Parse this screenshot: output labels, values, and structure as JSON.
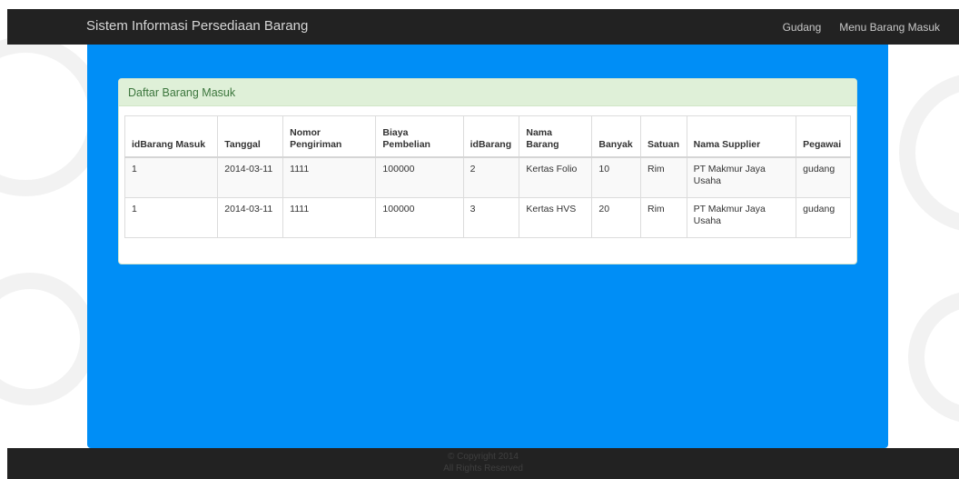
{
  "navbar": {
    "brand": "Sistem Informasi Persediaan Barang",
    "links": [
      {
        "label": "Gudang"
      },
      {
        "label": "Menu Barang Masuk"
      }
    ]
  },
  "panel": {
    "title": "Daftar Barang Masuk"
  },
  "table": {
    "headers": [
      "idBarang Masuk",
      "Tanggal",
      "Nomor Pengiriman",
      "Biaya Pembelian",
      "idBarang",
      "Nama Barang",
      "Banyak",
      "Satuan",
      "Nama Supplier",
      "Pegawai"
    ],
    "rows": [
      [
        "1",
        "2014-03-11",
        "1111",
        "100000",
        "2",
        "Kertas Folio",
        "10",
        "Rim",
        "PT Makmur Jaya Usaha",
        "gudang"
      ],
      [
        "1",
        "2014-03-11",
        "1111",
        "100000",
        "3",
        "Kertas HVS",
        "20",
        "Rim",
        "PT Makmur Jaya Usaha",
        "gudang"
      ]
    ]
  },
  "footer": {
    "copyright": "© Copyright 2014",
    "rights": "All Rights Reserved"
  },
  "colors": {
    "navbar": "#222222",
    "content_bg": "#008ef6",
    "panel_heading_bg": "#dff0d8",
    "panel_heading_text": "#3c763d"
  }
}
